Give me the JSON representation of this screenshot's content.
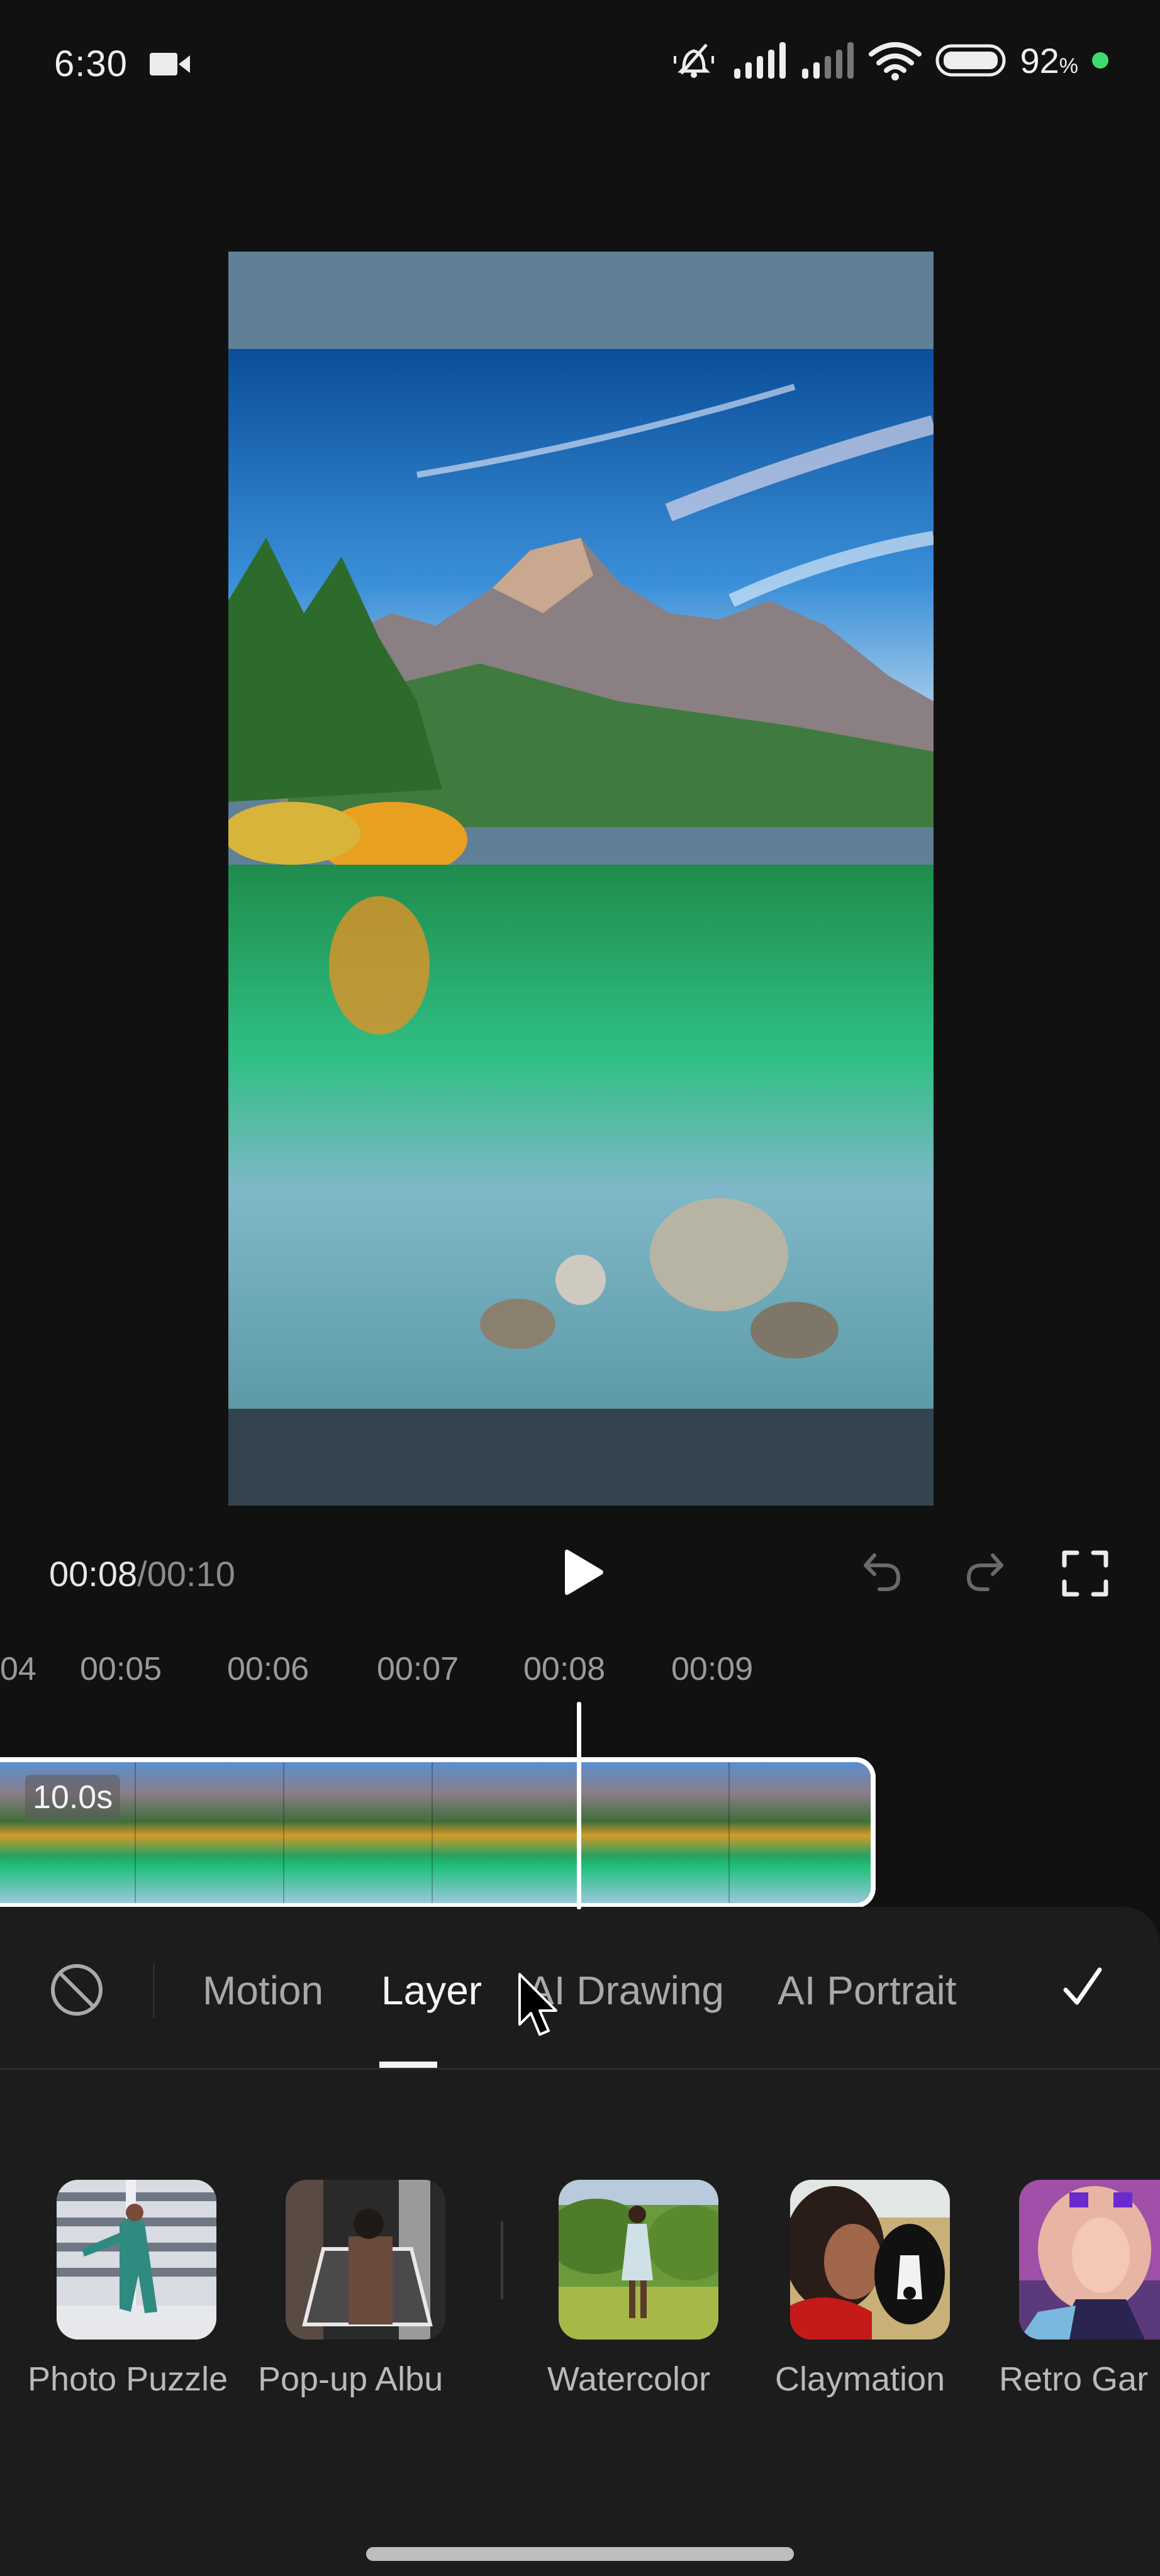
{
  "status_bar": {
    "time": "6:30",
    "recording_icon": "video-camera-icon",
    "icons": [
      "bell-off-icon",
      "signal-icon",
      "signal-weak-icon",
      "wifi-icon",
      "battery-icon"
    ],
    "battery_percent": "92",
    "battery_percent_sign": "%",
    "dot_color": "#3ddc6f"
  },
  "preview": {
    "description": "Mountain lake landscape with autumn trees and reflections",
    "top_bar_color": "#5f8096",
    "bottom_bar_color": "#33444f"
  },
  "playback": {
    "current_time": "00:08",
    "separator": "/",
    "total_time": "00:10",
    "play_icon": "play-icon",
    "undo_icon": "undo-icon",
    "redo_icon": "redo-icon",
    "fullscreen_icon": "fullscreen-icon"
  },
  "ruler": {
    "ticks": [
      "04",
      "00:05",
      "00:06",
      "00:07",
      "00:08",
      "00:09"
    ]
  },
  "timeline": {
    "clip_duration": "10.0s",
    "frame_count": 6
  },
  "effect_panel": {
    "none_icon": "no-effect-icon",
    "tabs": [
      {
        "label": "Motion",
        "active": false
      },
      {
        "label": "Layer",
        "active": true
      },
      {
        "label": "AI Drawing",
        "active": false
      },
      {
        "label": "AI Portrait",
        "active": false
      }
    ],
    "confirm_icon": "checkmark-icon",
    "effects": [
      {
        "label": "Photo Puzzle"
      },
      {
        "label": "Pop-up Albu"
      },
      {
        "label": "Watercolor"
      },
      {
        "label": "Claymation"
      },
      {
        "label": "Retro Gar"
      }
    ]
  }
}
